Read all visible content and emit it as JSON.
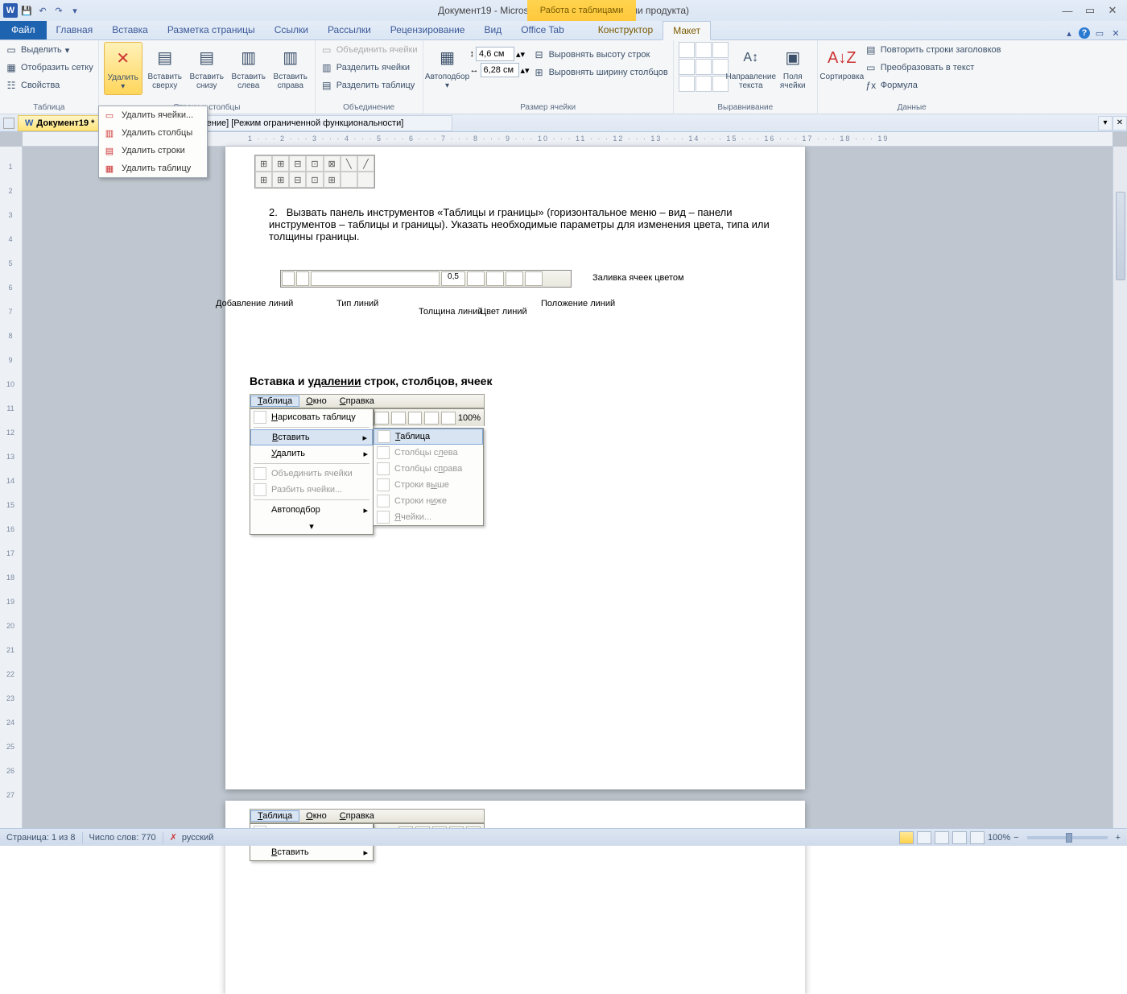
{
  "title": "Документ19 - Microsoft Word (Сбой активации продукта)",
  "tooltab": "Работа с таблицами",
  "tabs": {
    "file": "Файл",
    "home": "Главная",
    "insert": "Вставка",
    "layout": "Разметка страницы",
    "refs": "Ссылки",
    "mail": "Рассылки",
    "review": "Рецензирование",
    "view": "Вид",
    "officetab": "Office Tab",
    "design": "Конструктор",
    "maket": "Макет"
  },
  "ribbon": {
    "table": {
      "select": "Выделить",
      "grid": "Отобразить сетку",
      "props": "Свойства",
      "label": "Таблица"
    },
    "rowscols": {
      "delete": "Удалить",
      "above": "Вставить сверху",
      "below": "Вставить снизу",
      "left": "Вставить слева",
      "right": "Вставить справа",
      "label": "Строки и столбцы"
    },
    "merge": {
      "mergeCells": "Объединить ячейки",
      "splitCells": "Разделить ячейки",
      "splitTable": "Разделить таблицу",
      "label": "Объединение"
    },
    "size": {
      "autofit": "Автоподбор",
      "height": "4,6 см",
      "width": "6,28 см",
      "distRows": "Выровнять высоту строк",
      "distCols": "Выровнять ширину столбцов",
      "label": "Размер ячейки"
    },
    "align": {
      "dir": "Направление текста",
      "margins": "Поля ячейки",
      "label": "Выравнивание"
    },
    "data": {
      "sort": "Сортировка",
      "repeat": "Повторить строки заголовков",
      "convert": "Преобразовать в текст",
      "formula": "Формула",
      "label": "Данные"
    }
  },
  "deleteMenu": {
    "cells": "Удалить ячейки...",
    "cols": "Удалить столбцы",
    "rows": "Удалить строки",
    "table": "Удалить таблицу"
  },
  "docTabs": {
    "active": "Документ19 *",
    "other": "аботы.doc [только чтение] [Режим ограниченной функциональности]"
  },
  "content": {
    "item2": "Вызвать панель инструментов «Таблицы и границы» (горизонтальное меню – вид – панели инструментов – таблицы и границы). Указать необходимые параметры для изменения цвета, типа или толщины границы.",
    "fig": {
      "addLines": "Добавление линий",
      "lineType": "Тип линий",
      "thickness": "Толщина линий",
      "lineColor": "Цвет линий",
      "linePos": "Положение линий",
      "fill": "Заливка ячеек цветом",
      "thickVal": "0,5"
    },
    "heading": "Вставка и удалении строк, столбцов, ячеек",
    "menu": {
      "table": "Таблица",
      "window": "Окно",
      "help": "Справка",
      "draw": "Нарисовать таблицу",
      "insert": "Вставить",
      "delete": "Удалить",
      "merge": "Объединить ячейки",
      "split": "Разбить ячейки...",
      "autofit": "Автоподбор",
      "zoom": "100%",
      "sub": {
        "table": "Таблица",
        "colsLeft": "Столбцы слева",
        "colsRight": "Столбцы справа",
        "rowsAbove": "Строки выше",
        "rowsBelow": "Строки ниже",
        "cells": "Ячейки..."
      }
    }
  },
  "status": {
    "page": "Страница: 1 из 8",
    "words": "Число слов: 770",
    "lang": "русский",
    "zoom": "100%"
  }
}
